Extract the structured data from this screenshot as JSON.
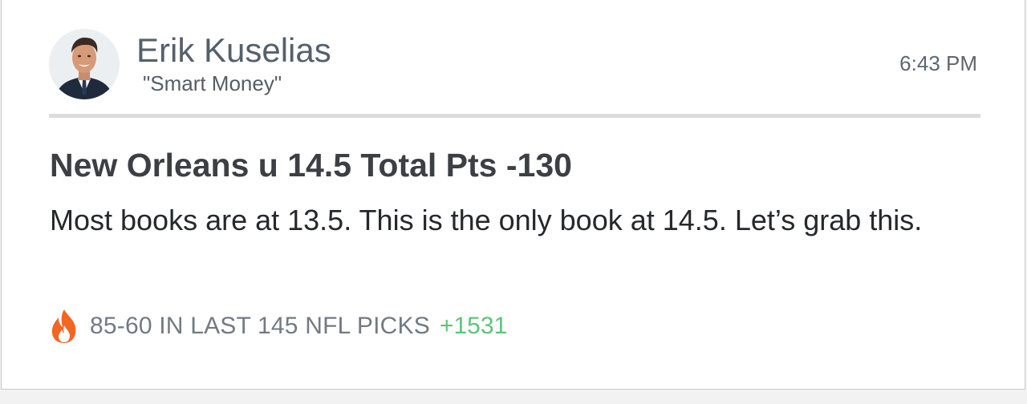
{
  "author": {
    "name": "Erik Kuselias",
    "tagline": "\"Smart Money\""
  },
  "timestamp": "6:43 PM",
  "pick": {
    "title": "New Orleans u 14.5 Total Pts -130",
    "body": "Most books are at 13.5. This is the only book at 14.5. Let’s grab this."
  },
  "record": {
    "icon": "fire-icon",
    "text": "85-60 IN LAST 145 NFL PICKS",
    "units": "+1531"
  },
  "colors": {
    "fire": "#f26522",
    "units_green": "#5ec47a",
    "divider": "#dcdcdc"
  }
}
